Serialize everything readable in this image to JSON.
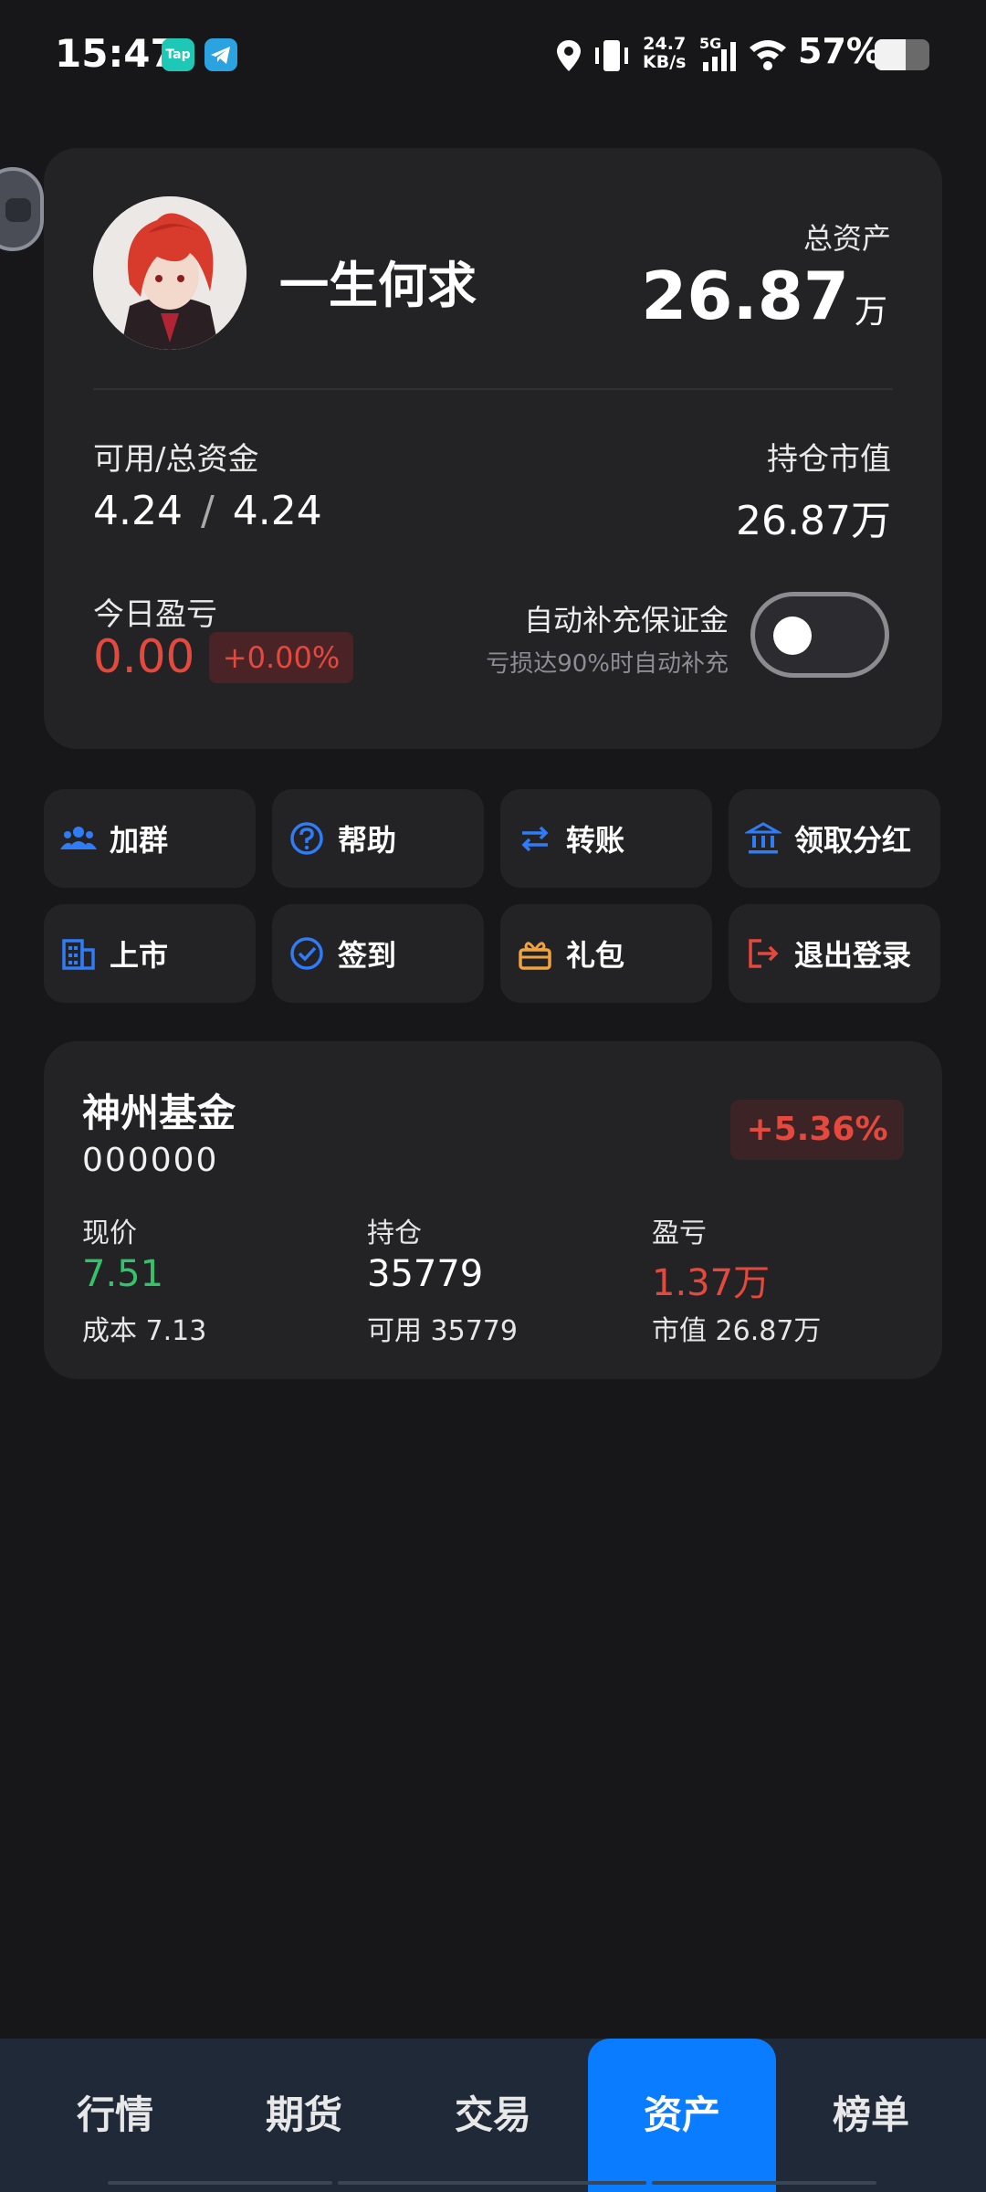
{
  "status_bar": {
    "time": "15:47",
    "tap_label": "Tap",
    "net_speed_value": "24.7",
    "net_speed_unit": "KB/s",
    "network": "5G",
    "battery_text": "57%",
    "battery_level": 0.57
  },
  "account": {
    "username": "一生何求",
    "total_assets_label": "总资产",
    "total_assets_value": "26.87",
    "total_assets_unit": "万",
    "available_label": "可用/总资金",
    "available_value": "4.24",
    "separator": "/",
    "total_funds_value": "4.24",
    "position_value_label": "持仓市值",
    "position_value": "26.87万",
    "today_pnl_label": "今日盈亏",
    "today_pnl_value": "0.00",
    "today_pnl_pct": "+0.00%",
    "auto_margin_label": "自动补充保证金",
    "auto_margin_desc": "亏损达90%时自动补充",
    "auto_margin_enabled": false
  },
  "actions": [
    {
      "label": "加群",
      "icon": "group-icon",
      "color": "#2f7cf6"
    },
    {
      "label": "帮助",
      "icon": "help-icon",
      "color": "#2f7cf6"
    },
    {
      "label": "转账",
      "icon": "transfer-icon",
      "color": "#2f7cf6"
    },
    {
      "label": "领取分红",
      "icon": "bank-icon",
      "color": "#2f7cf6"
    },
    {
      "label": "上市",
      "icon": "building-icon",
      "color": "#2f7cf6"
    },
    {
      "label": "签到",
      "icon": "check-circle-icon",
      "color": "#2f7cf6"
    },
    {
      "label": "礼包",
      "icon": "gift-icon",
      "color": "#f0a440"
    },
    {
      "label": "退出登录",
      "icon": "logout-icon",
      "color": "#e5483d"
    }
  ],
  "fund": {
    "name": "神州基金",
    "code": "000000",
    "change_pct": "+5.36%",
    "price_label": "现价",
    "price": "7.51",
    "cost": "成本 7.13",
    "holding_label": "持仓",
    "holding": "35779",
    "available": "可用 35779",
    "pnl_label": "盈亏",
    "pnl": "1.37万",
    "market_value": "市值 26.87万"
  },
  "nav": {
    "items": [
      "行情",
      "期货",
      "交易",
      "资产",
      "榜单"
    ],
    "active": "资产"
  }
}
